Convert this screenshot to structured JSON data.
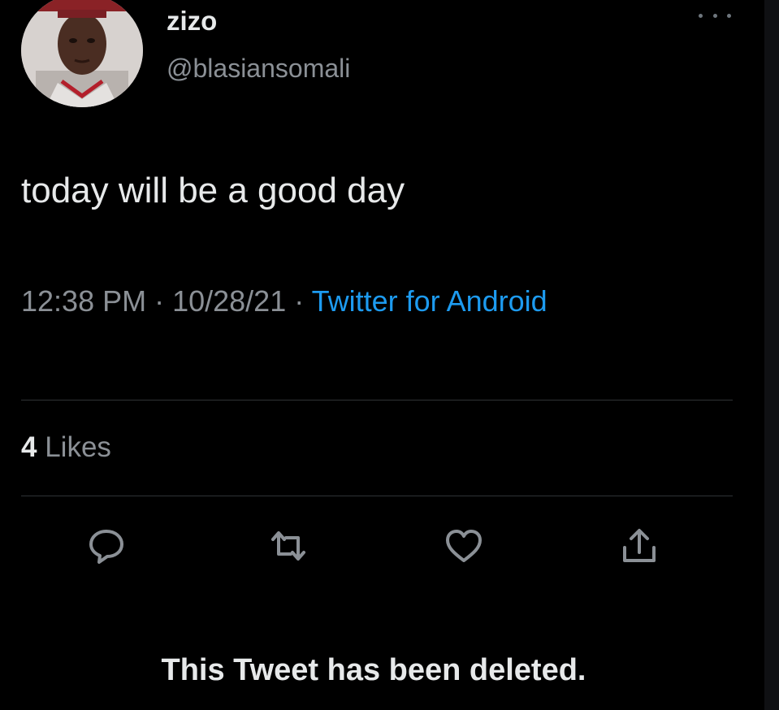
{
  "author": {
    "display_name": "zizo",
    "handle": "@blasiansomali"
  },
  "tweet": {
    "text": "today will be a good day",
    "time": "12:38 PM",
    "date": "10/28/21",
    "separator": " · ",
    "source": "Twitter for Android"
  },
  "stats": {
    "likes_count": "4",
    "likes_label": "Likes"
  },
  "actions": [
    {
      "icon": "reply-icon"
    },
    {
      "icon": "retweet-icon"
    },
    {
      "icon": "like-icon"
    },
    {
      "icon": "share-icon"
    }
  ],
  "notice": {
    "deleted_text": "This Tweet has been deleted."
  },
  "colors": {
    "background": "#000000",
    "primary_text": "#e7e9ea",
    "secondary_text": "#8b9096",
    "link": "#1d9bf0",
    "divider": "#2f3336"
  }
}
